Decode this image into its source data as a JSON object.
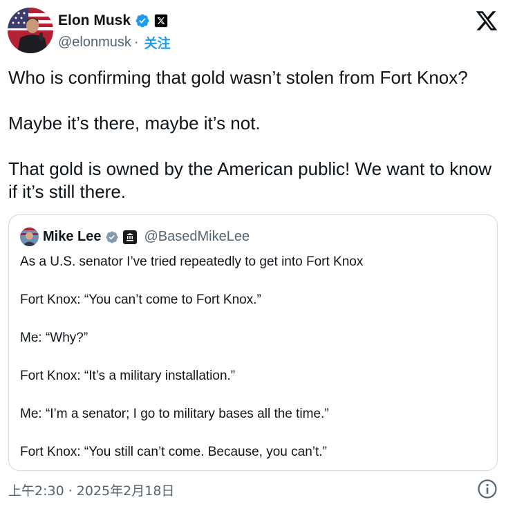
{
  "author": {
    "name": "Elon Musk",
    "handle": "@elonmusk",
    "separator": "·",
    "follow_label": "关注"
  },
  "tweet": {
    "paragraphs": [
      "Who is confirming that gold wasn’t stolen from Fort Knox?",
      "Maybe it’s there, maybe it’s not.",
      "That gold is owned by the American public! We want to know if it’s still there."
    ]
  },
  "quoted": {
    "name": "Mike Lee",
    "handle": "@BasedMikeLee",
    "lines": [
      "As a U.S. senator I’ve tried repeatedly to get into Fort Knox",
      "Fort Knox: “You can’t come to Fort Knox.”",
      "Me: “Why?”",
      "Fort Knox: “It’s a military installation.”",
      "Me: “I’m a senator; I go to military bases all the time.”",
      "Fort Knox: “You still can’t come. Because, you can’t.”"
    ]
  },
  "timestamp": "上午2:30 · 2025年2月18日",
  "icons": {
    "verified": "verified-badge-icon",
    "x_affiliation": "x-affiliation-icon",
    "x_logo": "x-logo-icon",
    "government": "government-building-icon",
    "info": "info-icon"
  },
  "colors": {
    "accent": "#1d9bf0",
    "text": "#0f1419",
    "muted": "#536471",
    "border": "#cfd9de"
  }
}
